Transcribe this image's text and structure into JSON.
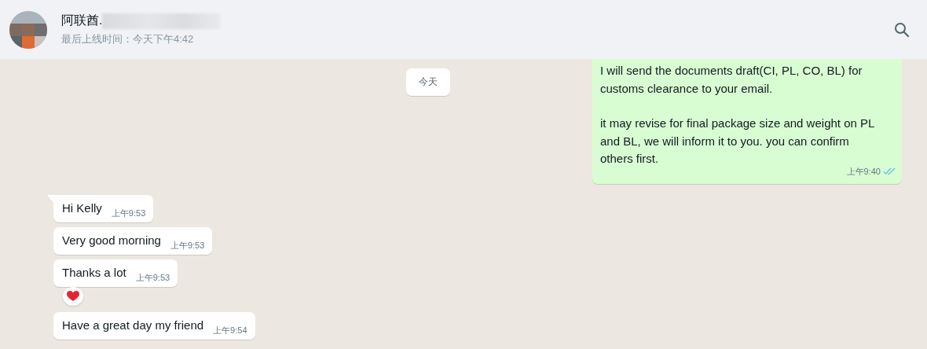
{
  "header": {
    "contact_name": "阿联酋.",
    "last_seen": "最后上线时间：今天下午4:42"
  },
  "date_chip": "今天",
  "messages": [
    {
      "kind": "sent",
      "paragraphs": [
        "I will send the documents draft(CI, PL, CO, BL) for customs clearance to your email.",
        "it may revise for final package size and weight on PL and BL, we will inform it to you. you can confirm others first."
      ],
      "time": "上午9:40",
      "read": true,
      "tail": false
    },
    {
      "kind": "received",
      "paragraphs": [
        "Hi Kelly"
      ],
      "time": "上午9:53",
      "tail": true,
      "reaction": false
    },
    {
      "kind": "received",
      "paragraphs": [
        "Very good morning"
      ],
      "time": "上午9:53",
      "tail": false,
      "reaction": false
    },
    {
      "kind": "received",
      "paragraphs": [
        "Thanks a lot"
      ],
      "time": "上午9:53",
      "tail": false,
      "reaction": true
    },
    {
      "kind": "received",
      "paragraphs": [
        "Have a great day my friend"
      ],
      "time": "上午9:54",
      "tail": false,
      "reaction": false
    }
  ]
}
